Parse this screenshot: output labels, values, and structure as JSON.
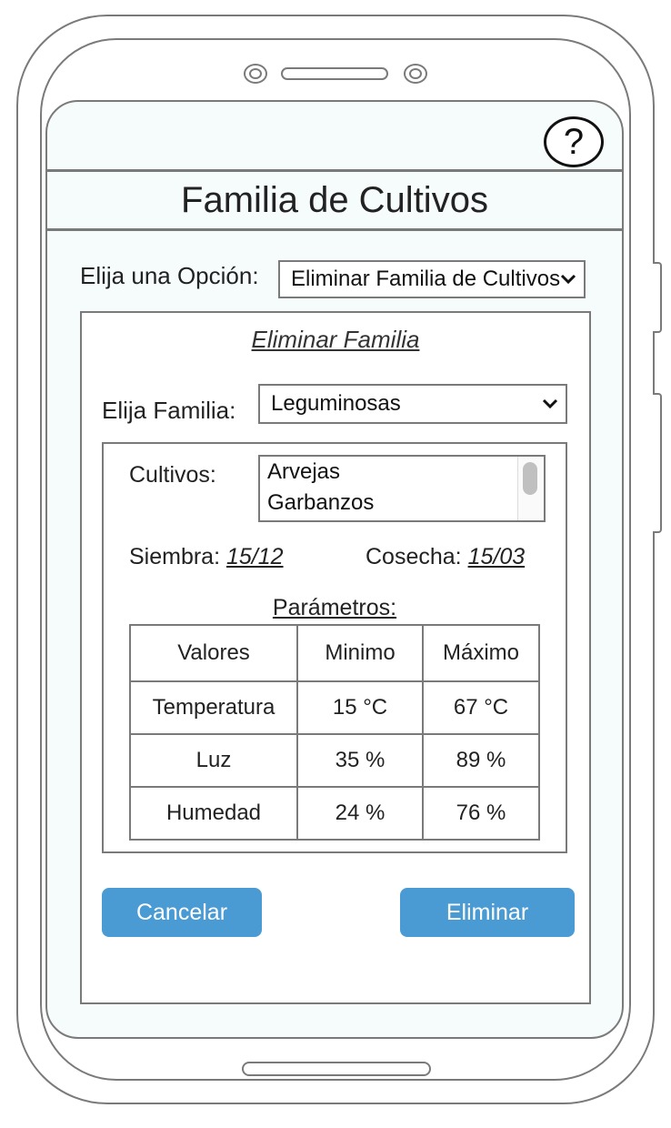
{
  "header": {
    "help_symbol": "?",
    "title": "Familia de Cultivos"
  },
  "option": {
    "label": "Elija una Opción:",
    "selected": "Eliminar Familia de Cultivos"
  },
  "panel": {
    "title": "Eliminar Familia",
    "family_label": "Elija Familia:",
    "family_selected": "Leguminosas",
    "crops_label": "Cultivos:",
    "crops": [
      "Arvejas",
      "Garbanzos"
    ],
    "sowing_label": "Siembra:",
    "sowing_value": "15/12",
    "harvest_label": "Cosecha:",
    "harvest_value": "15/03",
    "params_title": "Parámetros:",
    "table": {
      "headers": [
        "Valores",
        "Minimo",
        "Máximo"
      ],
      "rows": [
        [
          "Temperatura",
          "15 °C",
          "67 °C"
        ],
        [
          "Luz",
          "35 %",
          "89 %"
        ],
        [
          "Humedad",
          "24 %",
          "76 %"
        ]
      ]
    }
  },
  "buttons": {
    "cancel": "Cancelar",
    "delete": "Eliminar"
  },
  "colors": {
    "button": "#4a9bd4",
    "screen_bg": "#f6fbfc"
  },
  "icons": {
    "help": "question-circle-icon",
    "dropdown": "chevron-down-icon"
  }
}
